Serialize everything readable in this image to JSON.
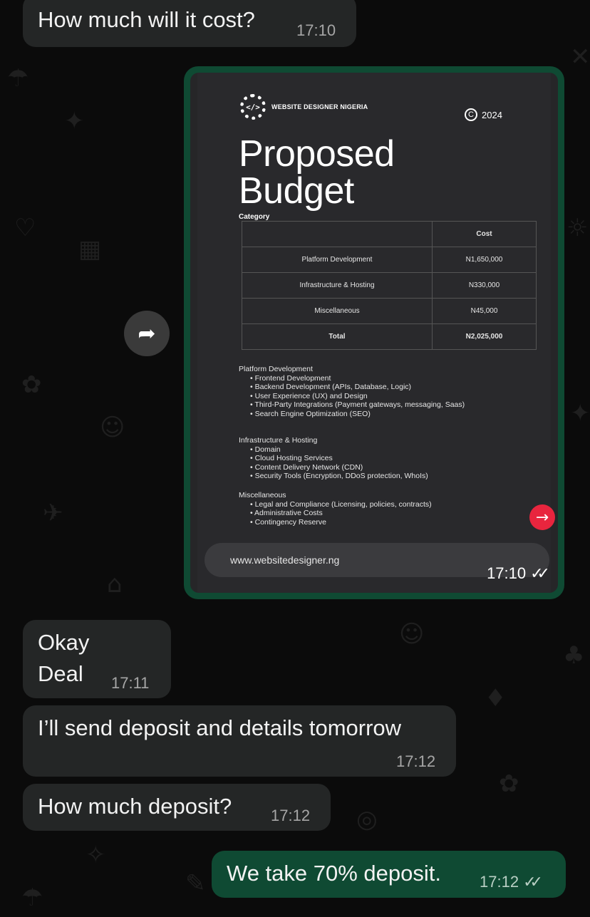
{
  "messages": [
    {
      "text": "How much will it cost?",
      "time": "17:10"
    },
    {
      "line1": "Okay",
      "line2": "Deal",
      "time": "17:11"
    },
    {
      "text": "I’ll send deposit and details tomorrow",
      "time": "17:12"
    },
    {
      "text": "How much deposit?",
      "time": "17:12"
    },
    {
      "text": "We take 70% deposit.",
      "time": "17:12",
      "status": "read"
    }
  ],
  "document": {
    "brand": "WEBSITE DESIGNER NIGERIA",
    "logo_glyph": "</>",
    "copyright_symbol": "C",
    "year": "2024",
    "title_line1": "Proposed",
    "title_line2": "Budget",
    "category_label": "Category",
    "cost_header": "Cost",
    "rows": [
      {
        "name": "Platform Development",
        "cost": "N1,650,000"
      },
      {
        "name": "Infrastructure & Hosting",
        "cost": "N330,000"
      },
      {
        "name": "Miscellaneous",
        "cost": "N45,000"
      }
    ],
    "total_label": "Total",
    "total_value": "N2,025,000",
    "sections": [
      {
        "title": "Platform Development",
        "items": [
          "Frontend Development",
          "Backend Development (APIs, Database, Logic)",
          "User Experience (UX) and Design",
          "Third-Party Integrations (Payment gateways, messaging, Saas)",
          "Search Engine Optimization (SEO)"
        ]
      },
      {
        "title": "Infrastructure & Hosting",
        "items": [
          "Domain",
          " Cloud Hosting Services",
          "Content Delivery Network (CDN)",
          "Security Tools (Encryption, DDoS protection, WhoIs)"
        ]
      },
      {
        "title": "Miscellaneous",
        "items": [
          "Legal and Compliance (Licensing, policies, contracts)",
          "Administrative Costs",
          "Contingency Reserve"
        ]
      }
    ],
    "url": "www.websitedesigner.ng",
    "time": "17:10",
    "status": "read"
  },
  "icons": {
    "forward": "forward-arrow-icon",
    "ticks": "double-check-icon",
    "doc_arrow": "arrow-right-icon"
  },
  "colors": {
    "incoming": "#242626",
    "outgoing": "#0f4a33",
    "background": "#0b0b0b",
    "accent_red": "#e8253e"
  }
}
